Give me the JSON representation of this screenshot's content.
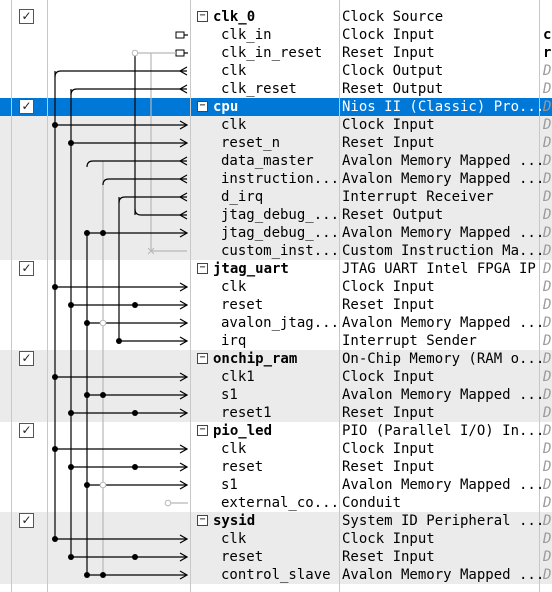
{
  "rows": [
    {
      "kind": "component",
      "checked": true,
      "name": "clk_0",
      "description": "Clock Source",
      "extra": ""
    },
    {
      "kind": "interface",
      "name": "clk_in",
      "description": "Clock Input",
      "extra": "c"
    },
    {
      "kind": "interface",
      "name": "clk_in_reset",
      "description": "Reset Input",
      "extra": "r"
    },
    {
      "kind": "interface",
      "name": "clk",
      "description": "Clock Output",
      "extra": "D"
    },
    {
      "kind": "interface",
      "name": "clk_reset",
      "description": "Reset Output",
      "extra": "D"
    },
    {
      "kind": "component",
      "checked": true,
      "selected": true,
      "name": "cpu",
      "description": "Nios II (Classic) Pro...",
      "extra": "D"
    },
    {
      "kind": "interface",
      "name": "clk",
      "description": "Clock Input",
      "extra": "D"
    },
    {
      "kind": "interface",
      "name": "reset_n",
      "description": "Reset Input",
      "extra": "D"
    },
    {
      "kind": "interface",
      "name": "data_master",
      "description": "Avalon Memory Mapped ...",
      "extra": "D"
    },
    {
      "kind": "interface",
      "name": "instruction...",
      "description": "Avalon Memory Mapped ...",
      "extra": "D"
    },
    {
      "kind": "interface",
      "name": "d_irq",
      "description": "Interrupt Receiver",
      "extra": "D"
    },
    {
      "kind": "interface",
      "name": "jtag_debug_...",
      "description": "Reset Output",
      "extra": "D"
    },
    {
      "kind": "interface",
      "name": "jtag_debug_...",
      "description": "Avalon Memory Mapped ...",
      "extra": "D"
    },
    {
      "kind": "interface",
      "name": "custom_inst...",
      "description": "Custom Instruction Ma...",
      "extra": "D"
    },
    {
      "kind": "component",
      "checked": true,
      "name": "jtag_uart",
      "description": "JTAG UART Intel FPGA IP",
      "extra": "D"
    },
    {
      "kind": "interface",
      "name": "clk",
      "description": "Clock Input",
      "extra": "D"
    },
    {
      "kind": "interface",
      "name": "reset",
      "description": "Reset Input",
      "extra": "D"
    },
    {
      "kind": "interface",
      "name": "avalon_jtag...",
      "description": "Avalon Memory Mapped ...",
      "extra": "D"
    },
    {
      "kind": "interface",
      "name": "irq",
      "description": "Interrupt Sender",
      "extra": "D"
    },
    {
      "kind": "component",
      "checked": true,
      "name": "onchip_ram",
      "description": "On-Chip Memory (RAM o...",
      "extra": "D"
    },
    {
      "kind": "interface",
      "name": "clk1",
      "description": "Clock Input",
      "extra": "D"
    },
    {
      "kind": "interface",
      "name": "s1",
      "description": "Avalon Memory Mapped ...",
      "extra": "D"
    },
    {
      "kind": "interface",
      "name": "reset1",
      "description": "Reset Input",
      "extra": "D"
    },
    {
      "kind": "component",
      "checked": true,
      "name": "pio_led",
      "description": "PIO (Parallel I/O) In...",
      "extra": "D"
    },
    {
      "kind": "interface",
      "name": "clk",
      "description": "Clock Input",
      "extra": "D"
    },
    {
      "kind": "interface",
      "name": "reset",
      "description": "Reset Input",
      "extra": "D"
    },
    {
      "kind": "interface",
      "name": "s1",
      "description": "Avalon Memory Mapped ...",
      "extra": "D"
    },
    {
      "kind": "interface",
      "name": "external_co...",
      "description": "Conduit",
      "extra": "D"
    },
    {
      "kind": "component",
      "checked": true,
      "name": "sysid",
      "description": "System ID Peripheral ...",
      "extra": "D"
    },
    {
      "kind": "interface",
      "name": "clk",
      "description": "Clock Input",
      "extra": "D"
    },
    {
      "kind": "interface",
      "name": "reset",
      "description": "Reset Input",
      "extra": "D"
    },
    {
      "kind": "interface",
      "name": "control_slave",
      "description": "Avalon Memory Mapped ...",
      "extra": "D"
    }
  ],
  "icons": {
    "checkbox": "check-icon",
    "collapse": "minus-icon",
    "port_arrow": "arrow-icon",
    "export_port": "export-icon",
    "connection_dot": "dot-icon"
  },
  "colors": {
    "selection": "#0078d7",
    "wire": "#000000",
    "inactive_wire": "#b8b8b8",
    "band_alt": "#ebebeb"
  }
}
